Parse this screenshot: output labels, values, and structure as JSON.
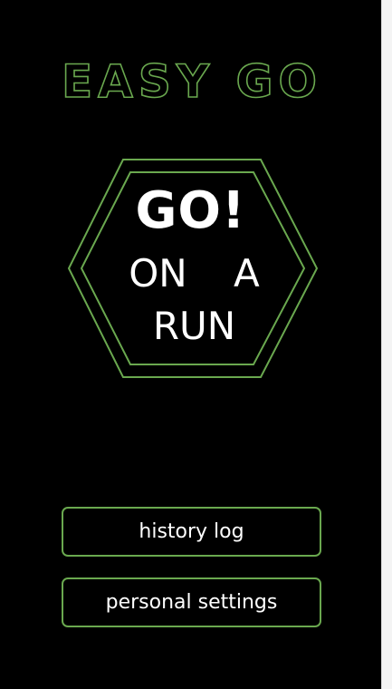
{
  "app": {
    "title": "EASY GO",
    "accent_color": "#6aa84f",
    "background_color": "#000000"
  },
  "main_action": {
    "headline": "GO!",
    "line1": "ON A",
    "line2": "RUN",
    "shape": "hexagon"
  },
  "menu": {
    "history_label": "history log",
    "settings_label": "personal settings"
  }
}
